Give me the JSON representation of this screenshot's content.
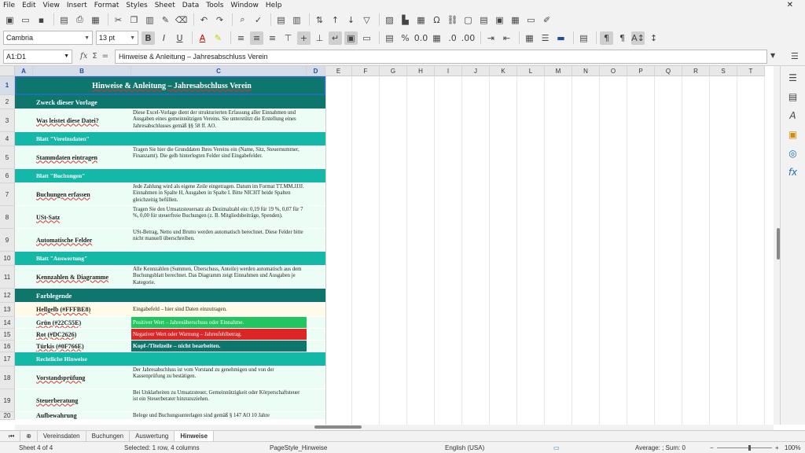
{
  "menubar": {
    "items": [
      "File",
      "Edit",
      "View",
      "Insert",
      "Format",
      "Styles",
      "Sheet",
      "Data",
      "Tools",
      "Window",
      "Help"
    ],
    "close_glyph": "✕"
  },
  "toolbar2": {
    "font_name": "Cambria",
    "font_size": "13 pt"
  },
  "formula_bar": {
    "cell_ref": "A1:D1",
    "fx": "fx",
    "sum": "Σ",
    "eq": "=",
    "content": "Hinweise & Anleitung – Jahresabschluss Verein"
  },
  "columns": [
    "A",
    "B",
    "C",
    "D",
    "E",
    "F",
    "G",
    "H",
    "I",
    "J",
    "K",
    "L",
    "M",
    "N",
    "O",
    "P",
    "Q",
    "R",
    "S",
    "T"
  ],
  "rows": [
    {
      "num": "1",
      "style": "title",
      "b": "Hinweise & Anleitung – Jahresabschluss Verein",
      "c": ""
    },
    {
      "num": "2",
      "style": "head",
      "b": "Zweck dieser Vorlage",
      "c": ""
    },
    {
      "num": "3",
      "style": "body",
      "b": "Was leistet diese Datei?",
      "c": "Diese Excel-Vorlage dient der strukturierten Erfassung aller Einnahmen und Ausgaben eines gemeinnützigen Vereins. Sie unterstützt die Erstellung eines Jahresabschlusses gemäß §§ 58 ff. AO."
    },
    {
      "num": "4",
      "style": "sub",
      "b": "Blatt \"Vereinsdaten\"",
      "c": ""
    },
    {
      "num": "5",
      "style": "body",
      "b": "Stammdaten eintragen",
      "c": "Tragen Sie hier die Grunddaten Ihres Vereins ein (Name, Sitz, Steuernummer, Finanzamt). Die gelb hinterlegten Felder sind Eingabefelder."
    },
    {
      "num": "6",
      "style": "sub",
      "b": "Blatt \"Buchungen\"",
      "c": ""
    },
    {
      "num": "7",
      "style": "body",
      "b": "Buchungen erfassen",
      "c": "Jede Zahlung wird als eigene Zeile eingetragen. Datum im Format TT.MM.JJJJ. Einnahmen in Spalte H, Ausgaben in Spalte I. Bitte NICHT beide Spalten gleichzeitig befüllen."
    },
    {
      "num": "8",
      "style": "body",
      "b": "USt-Satz",
      "c": "Tragen Sie den Umsatzsteuersatz als Dezimalzahl ein: 0,19 für 19 %, 0,07 für 7 %, 0,00 für steuerfreie Buchungen (z. B. Mitgliedsbeiträge, Spenden)."
    },
    {
      "num": "9",
      "style": "body",
      "b": "Automatische Felder",
      "c": "USt-Betrag, Netto und Brutto werden automatisch berechnet. Diese Felder bitte nicht manuell überschreiben."
    },
    {
      "num": "10",
      "style": "sub",
      "b": "Blatt \"Auswertung\"",
      "c": ""
    },
    {
      "num": "11",
      "style": "body",
      "b": "Kennzahlen & Diagramme",
      "c": "Alle Kennzahlen (Summen, Überschuss, Anteile) werden automatisch aus dem Buchungsblatt berechnet. Das Diagramm zeigt Einnahmen und Ausgaben je Kategorie."
    },
    {
      "num": "12",
      "style": "head",
      "b": "Farblegende",
      "c": ""
    },
    {
      "num": "13",
      "style": "legend-yellow",
      "b": "Hellgelb (#FFFBE8)",
      "c": "Eingabefeld – hier sind Daten einzutragen."
    },
    {
      "num": "14",
      "style": "legend-green",
      "b": "Grün (#22C55E)",
      "c": "Positiver Wert – Jahresüberschuss oder Einnahme."
    },
    {
      "num": "15",
      "style": "legend-red",
      "b": "Rot (#DC2626)",
      "c": "Negativer Wert oder Warnung – Jahresfehlbetrag."
    },
    {
      "num": "16",
      "style": "legend-teal",
      "b": "Türkis (#0F766E)",
      "c": "Kopf-/Titelzeile – nicht bearbeiten."
    },
    {
      "num": "17",
      "style": "sub",
      "b": "Rechtliche Hinweise",
      "c": ""
    },
    {
      "num": "18",
      "style": "body",
      "b": "Vorstandsprüfung",
      "c": "Der Jahresabschluss ist vom Vorstand zu genehmigen und von der Kassenprüfung zu bestätigen."
    },
    {
      "num": "19",
      "style": "body",
      "b": "Steuerberatung",
      "c": "Bei Unklarheiten zu Umsatzsteuer, Gemeinnützigkeit oder Körperschaftsteuer ist ein Steuerberater hinzuzuziehen."
    },
    {
      "num": "20",
      "style": "body",
      "b": "Aufbewahrung",
      "c": "Belege und Buchungsunterlagen sind gemäß § 147 AO 10 Jahre"
    }
  ],
  "tabs": [
    "Vereinsdaten",
    "Buchungen",
    "Auswertung",
    "Hinweise"
  ],
  "active_tab": "Hinweise",
  "statusbar": {
    "sheet": "Sheet 4 of 4",
    "selection": "Selected: 1 row, 4 columns",
    "pagestyle": "PageStyle_Hinweise",
    "language": "English (USA)",
    "summary": "Average: ; Sum: 0",
    "zoom": "100%"
  },
  "colors": {
    "title": "#0F766E",
    "head": "#0F766E",
    "sub": "#14B8A6",
    "body": "#ECFDF5",
    "yellow": "#FFFBE8",
    "green": "#22C55E",
    "red": "#DC2626",
    "teal": "#0F766E"
  }
}
